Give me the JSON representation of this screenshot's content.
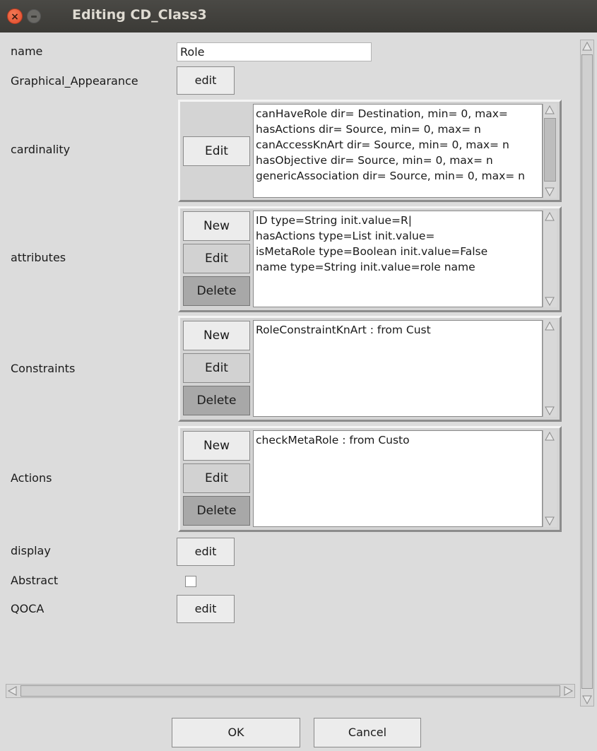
{
  "window": {
    "title": "Editing CD_Class3"
  },
  "fields": {
    "name_label": "name",
    "name_value": "Role",
    "graphical_label": "Graphical_Appearance",
    "graphical_button": "edit",
    "cardinality_label": "cardinality",
    "attributes_label": "attributes",
    "constraints_label": "Constraints",
    "actions_label": "Actions",
    "display_label": "display",
    "display_button": "edit",
    "abstract_label": "Abstract",
    "abstract_checked": false,
    "qoca_label": "QOCA",
    "qoca_button": "edit"
  },
  "cardinality": {
    "edit_label": "Edit",
    "lines": [
      "canHaveRole dir= Destination, min= 0, max=",
      "hasActions dir= Source, min= 0, max= n",
      "canAccessKnArt dir= Source, min= 0, max= n",
      "hasObjective dir= Source, min= 0, max= n",
      "genericAssociation dir= Source, min= 0, max= n"
    ]
  },
  "attributes": {
    "new_label": "New",
    "edit_label": "Edit",
    "delete_label": "Delete",
    "lines": [
      "ID type=String init.value=R|",
      "hasActions type=List init.value=",
      "isMetaRole type=Boolean init.value=False",
      "name type=String init.value=role name"
    ]
  },
  "constraints": {
    "new_label": "New",
    "edit_label": "Edit",
    "delete_label": "Delete",
    "lines": [
      "RoleConstraintKnArt :  from Cust"
    ]
  },
  "actions": {
    "new_label": "New",
    "edit_label": "Edit",
    "delete_label": "Delete",
    "lines": [
      "checkMetaRole : from Custo"
    ]
  },
  "footer": {
    "ok_label": "OK",
    "cancel_label": "Cancel"
  }
}
